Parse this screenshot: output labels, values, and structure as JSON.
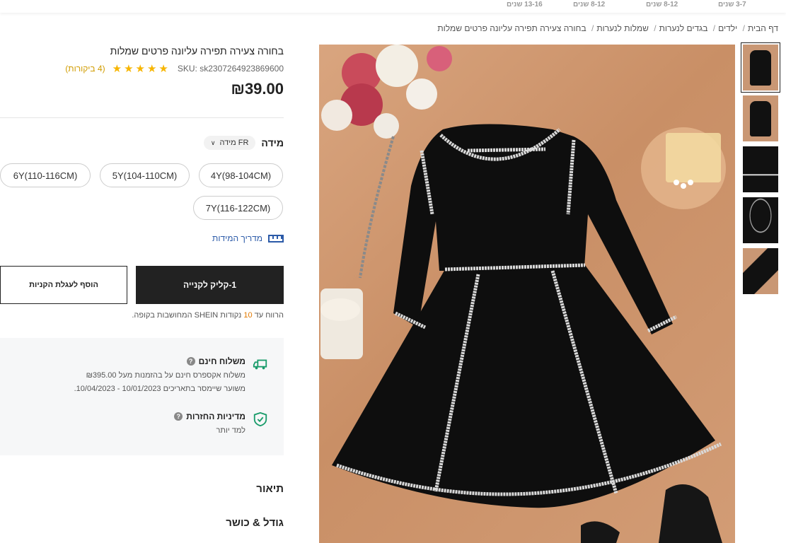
{
  "age_nav": [
    "13-16 שנים",
    "8-12 שנים",
    "8-12 שנים",
    "3-7 שנים"
  ],
  "breadcrumb": [
    "דף הבית",
    "ילדים",
    "בגדים לנערות",
    "שמלות לנערות",
    "בחורה צעירה תפירה עליונה פרטים שמלות"
  ],
  "product": {
    "title": "בחורה צעירה תפירה עליונה פרטים שמלות",
    "sku": "SKU: sk2307264923869600",
    "stars": "★★★★★",
    "reviews": "(4 ביקורות)",
    "price": "₪39.00"
  },
  "size": {
    "label": "מידה",
    "select_value": "FR מידה",
    "options": [
      "4Y(98-104CM)",
      "5Y(104-110CM)",
      "6Y(110-116CM)",
      "7Y(116-122CM)"
    ],
    "guide": "מדריך המידות"
  },
  "buttons": {
    "buy": "1-קליק לקנייה",
    "cart": "הוסף לעגלת הקניות"
  },
  "points": {
    "prefix": "הרווח עד",
    "value": "10",
    "suffix": "נקודות SHEIN המחושבות בקופה."
  },
  "shipping": {
    "title": "משלוח חינם",
    "line1": "משלוח אקספרס חינם על בהזמנות מעל ₪395.00",
    "line2": "משוער שיימסר בתאריכים 10/01/2023 - 10/04/2023.",
    "returns_title": "מדיניות החזרות",
    "returns_link": "למד יותר"
  },
  "sections": {
    "description": "תיאור",
    "size_fit": "גודל & כושר"
  },
  "colors": {
    "accent_blue": "#2b5aa8",
    "star": "#f7b500",
    "points": "#e27a00",
    "buy_bg": "#222222"
  }
}
